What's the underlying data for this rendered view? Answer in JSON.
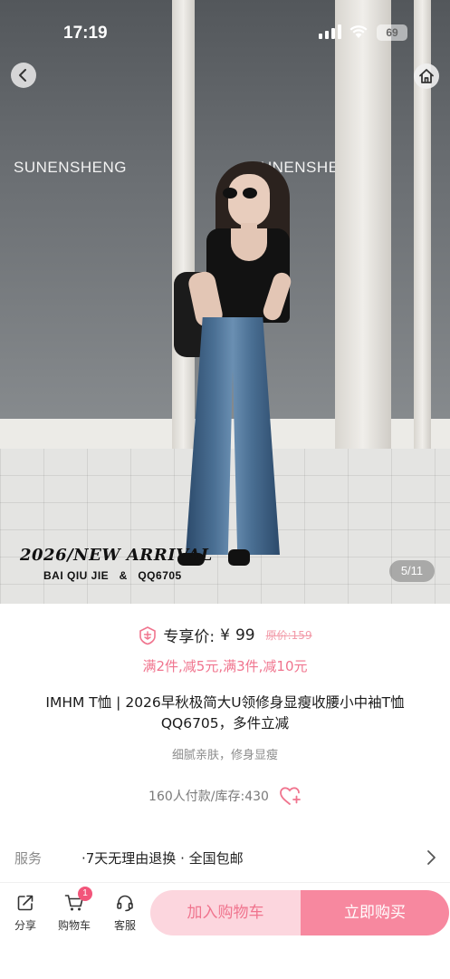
{
  "status_bar": {
    "time": "17:19",
    "battery": "69"
  },
  "hero": {
    "store_sign_left": "SUNENSHENG",
    "store_sign_right": "SUNENSHENG",
    "arrival_title": "2026/NEW ARRIVAL",
    "arrival_subtitle": "BAI QIU JIE   &   QQ6705",
    "image_counter": "5/11"
  },
  "price": {
    "label": "专享价:",
    "currency": "¥",
    "value": "99",
    "original": "原价:159",
    "promo": "满2件,减5元,满3件,减10元"
  },
  "product": {
    "title": "IMHM T恤 | 2026早秋极简大U领修身显瘦收腰小中袖T恤QQ6705，多件立减",
    "subtitle": "细腻亲肤，修身显瘦",
    "stock": "160人付款/库存:430"
  },
  "service": {
    "label": "服务",
    "text": "·7天无理由退换 · 全国包邮"
  },
  "bottom_bar": {
    "share": "分享",
    "cart": "购物车",
    "cart_badge": "1",
    "support": "客服",
    "add_to_cart": "加入购物车",
    "buy_now": "立即购买"
  },
  "colors": {
    "accent": "#f0748e",
    "cart_button": "#fcd6de",
    "buy_button": "#f7889f",
    "badge": "#f2557a"
  }
}
